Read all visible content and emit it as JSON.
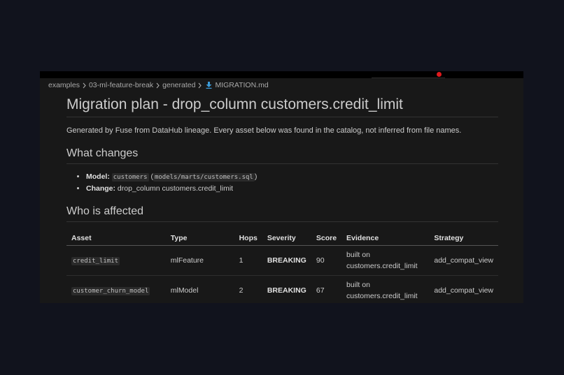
{
  "breadcrumb": {
    "items": [
      "examples",
      "03-ml-feature-break",
      "generated"
    ],
    "file": "MIGRATION.md"
  },
  "doc": {
    "title": "Migration plan - drop_column customers.credit_limit",
    "lead": "Generated by Fuse from DataHub lineage. Every asset below was found in the catalog, not inferred from file names.",
    "what_changes": {
      "heading": "What changes",
      "model_label": "Model:",
      "model_code": "customers",
      "model_path_open": "(",
      "model_path": "models/marts/customers.sql",
      "model_path_close": ")",
      "change_label": "Change:",
      "change_value": "drop_column customers.credit_limit"
    },
    "who_affected": {
      "heading": "Who is affected",
      "columns": [
        "Asset",
        "Type",
        "Hops",
        "Severity",
        "Score",
        "Evidence",
        "Strategy"
      ],
      "rows": [
        {
          "asset": "credit_limit",
          "type": "mlFeature",
          "hops": "1",
          "severity": "BREAKING",
          "score": "90",
          "evidence_line1": "built on",
          "evidence_line2": "customers.credit_limit",
          "strategy": "add_compat_view"
        },
        {
          "asset": "customer_churn_model",
          "type": "mlModel",
          "hops": "2",
          "severity": "BREAKING",
          "score": "67",
          "evidence_line1": "built on",
          "evidence_line2": "customers.credit_limit",
          "strategy": "add_compat_view"
        }
      ]
    }
  },
  "colors": {
    "background": "#11131d",
    "editor": "#181818",
    "recording_dot": "#e0191d",
    "file_icon": "#3b9bd9"
  },
  "icons": {
    "chevron": "chevron-right-icon",
    "file": "download-arrow-icon",
    "recording": "record-dot-icon"
  }
}
